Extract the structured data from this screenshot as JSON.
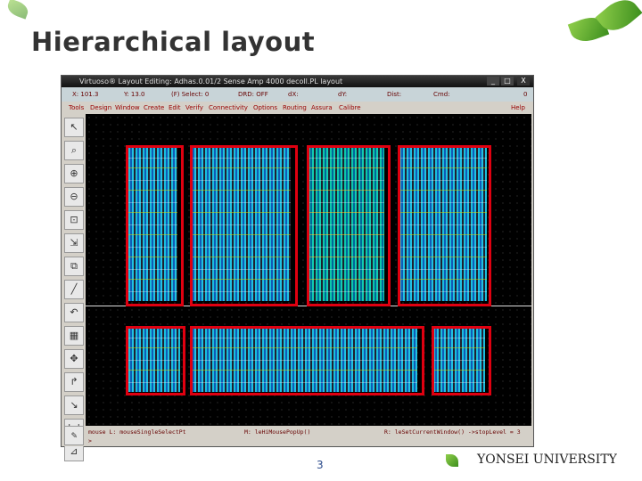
{
  "slide": {
    "title": "Hierarchical layout",
    "page_number": "3",
    "logo_text": "YONSEI UNIVERSITY"
  },
  "window": {
    "title": "Virtuoso® Layout Editing: Adhas.0.01/2 Sense Amp 4000 decoll.PL layout",
    "controls": [
      "_",
      "□",
      "X"
    ],
    "status": {
      "x": "X: 101.3",
      "y": "Y: 13.0",
      "select": "(F) Select: 0",
      "drd": "DRD: OFF",
      "dx": "dX:",
      "dy": "dY:",
      "dist": "Dist:",
      "cmd": "Cmd:",
      "num": "0"
    },
    "menu": [
      "Tools",
      "Design",
      "Window",
      "Create",
      "Edit",
      "Verify",
      "Connectivity",
      "Options",
      "Routing",
      "Assura",
      "Calibre"
    ],
    "help": "Help",
    "bottom": {
      "left": "mouse L: mouseSingleSelectPt",
      "mid": "M: leHiMousePopUp()",
      "right": "R: leSetCurrentWindow() ->stopLevel = 3",
      "prompt": ">"
    }
  },
  "colors": {
    "highlight": "#e00010",
    "metal": "#1cc8e8"
  }
}
